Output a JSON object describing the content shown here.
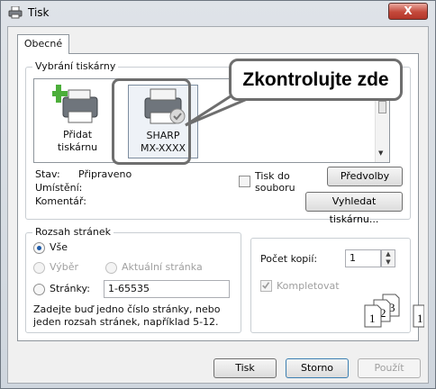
{
  "window": {
    "title": "Tisk",
    "close_label": "X"
  },
  "tabs": [
    {
      "label": "Obecné"
    }
  ],
  "select_printer": {
    "group_label": "Vybrání tiskárny",
    "add_printer": {
      "line1": "Přidat",
      "line2": "tiskárnu"
    },
    "selected_printer": {
      "line1": "SHARP",
      "line2": "MX-XXXX"
    },
    "status_label": "Stav:",
    "status_value": "Připraveno",
    "location_label": "Umístění:",
    "comment_label": "Komentář:",
    "print_to_file": {
      "line1": "Tisk do",
      "line2": "souboru"
    },
    "preferences_button": "Předvolby",
    "find_printer_button": "Vyhledat tiskárnu..."
  },
  "callout": {
    "text": "Zkontrolujte zde"
  },
  "page_range": {
    "group_label": "Rozsah stránek",
    "all_label": "Vše",
    "selection_label": "Výběr",
    "current_page_label": "Aktuální stránka",
    "pages_label": "Stránky:",
    "pages_value": "1-65535",
    "hint_line1": "Zadejte buď jedno číslo stránky, nebo",
    "hint_line2": "jeden rozsah stránek, například 5-12."
  },
  "copies": {
    "label": "Počet kopií:",
    "value": "1",
    "collate_label": "Kompletovat",
    "collate_digits": [
      "1",
      "2",
      "3",
      "1"
    ]
  },
  "footer": {
    "print_button": "Tisk",
    "cancel_button": "Storno",
    "apply_button": "Použít"
  }
}
